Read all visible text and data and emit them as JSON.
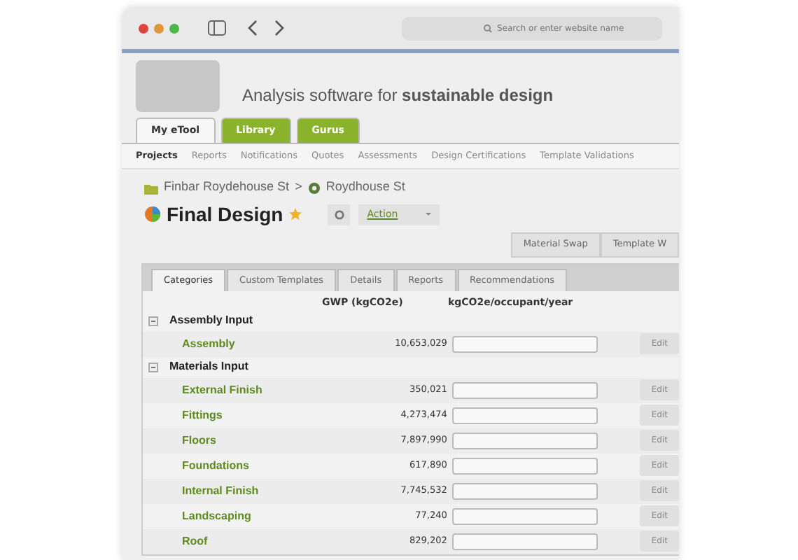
{
  "browser": {
    "search_placeholder": "Search or enter website name"
  },
  "header": {
    "tagline": "Analysis software for **sustainable design**"
  },
  "main_tabs": [
    {
      "label": "My eTool",
      "selected": true
    },
    {
      "label": "Library",
      "selected": false
    },
    {
      "label": "Gurus",
      "selected": false
    }
  ],
  "subnav": [
    {
      "label": "Projects",
      "selected": true
    },
    {
      "label": "Reports",
      "selected": false
    },
    {
      "label": "Notifications",
      "selected": false
    },
    {
      "label": "Quotes",
      "selected": false
    },
    {
      "label": "Assessments",
      "selected": false
    },
    {
      "label": "Design Certifications",
      "selected": false
    },
    {
      "label": "Template Validations",
      "selected": false
    }
  ],
  "breadcrumb": [
    "Finbar Roydehouse St",
    "Roydhouse St"
  ],
  "breadcrumb_separator": ">",
  "title": "Final Design",
  "starred": true,
  "action_dropdown": "Action",
  "toolbar_buttons": [
    "Material Swap",
    "Template W"
  ],
  "content_tabs": [
    {
      "label": "Categories",
      "selected": true
    },
    {
      "label": "Custom Templates",
      "selected": false
    },
    {
      "label": "Details",
      "selected": false
    },
    {
      "label": "Reports",
      "selected": false
    },
    {
      "label": "Recommendations",
      "selected": false
    }
  ],
  "table": {
    "columns": [
      "GWP (kgCO2e)",
      "kgCO2e/occupant/year"
    ],
    "groups": [
      {
        "name": "Assembly Input",
        "expanded": true,
        "children": [
          {
            "name": "Assembly",
            "gwp": "10,653,029",
            "action": "Edit"
          }
        ]
      },
      {
        "name": "Materials Input",
        "expanded": true,
        "children": [
          {
            "name": "External Finish",
            "gwp": "350,021",
            "action": "Edit"
          },
          {
            "name": "Fittings",
            "gwp": "4,273,474",
            "action": "Edit"
          },
          {
            "name": "Floors",
            "gwp": "7,897,990",
            "action": "Edit"
          },
          {
            "name": "Foundations",
            "gwp": "617,890",
            "action": "Edit"
          },
          {
            "name": "Internal Finish",
            "gwp": "7,745,532",
            "action": "Edit"
          },
          {
            "name": "Landscaping",
            "gwp": "77,240",
            "action": "Edit"
          },
          {
            "name": "Roof",
            "gwp": "829,202",
            "action": "Edit"
          }
        ]
      }
    ]
  }
}
